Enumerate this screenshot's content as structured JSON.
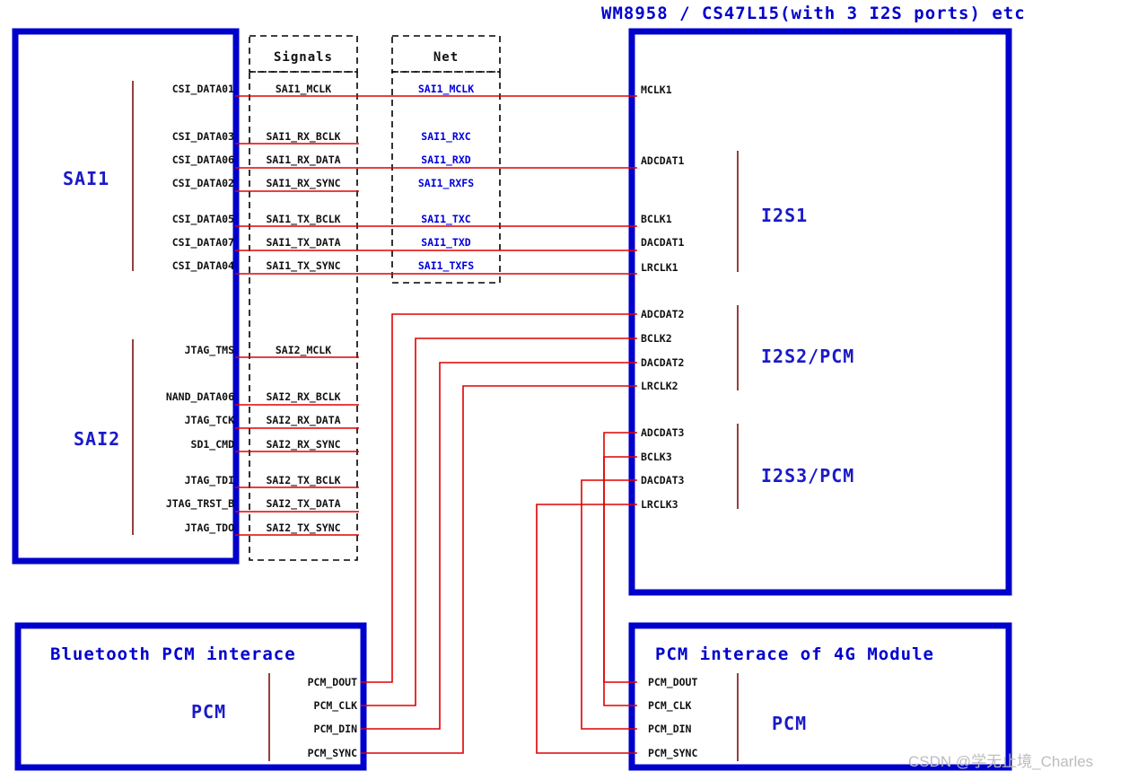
{
  "title": "WM8958 / CS47L15(with 3 I2S ports) etc",
  "watermark": "CSDN @学无止境_Charles",
  "colors": {
    "blue": "#0000cc",
    "red": "#e00000",
    "darkred": "#7a1010",
    "black": "#111111"
  },
  "columns": {
    "signals_header": "Signals",
    "net_header": "Net"
  },
  "soc_box": {
    "groups": [
      {
        "label": "SAI1",
        "pins": [
          "CSI_DATA01",
          "CSI_DATA03",
          "CSI_DATA06",
          "CSI_DATA02",
          "CSI_DATA05",
          "CSI_DATA07",
          "CSI_DATA04"
        ]
      },
      {
        "label": "SAI2",
        "pins": [
          "JTAG_TMS",
          "NAND_DATA06",
          "JTAG_TCK",
          "SD1_CMD",
          "JTAG_TDI",
          "JTAG_TRST_B",
          "JTAG_TDO"
        ]
      }
    ]
  },
  "signals": [
    "SAI1_MCLK",
    "SAI1_RX_BCLK",
    "SAI1_RX_DATA",
    "SAI1_RX_SYNC",
    "SAI1_TX_BCLK",
    "SAI1_TX_DATA",
    "SAI1_TX_SYNC",
    "SAI2_MCLK",
    "SAI2_RX_BCLK",
    "SAI2_RX_DATA",
    "SAI2_RX_SYNC",
    "SAI2_TX_BCLK",
    "SAI2_TX_DATA",
    "SAI2_TX_SYNC"
  ],
  "nets": [
    "SAI1_MCLK",
    "SAI1_RXC",
    "SAI1_RXD",
    "SAI1_RXFS",
    "SAI1_TXC",
    "SAI1_TXD",
    "SAI1_TXFS"
  ],
  "codec_box": {
    "groups": [
      {
        "label": "I2S1",
        "pins": [
          "MCLK1",
          "ADCDAT1",
          "BCLK1",
          "DACDAT1",
          "LRCLK1"
        ]
      },
      {
        "label": "I2S2/PCM",
        "pins": [
          "ADCDAT2",
          "BCLK2",
          "DACDAT2",
          "LRCLK2"
        ]
      },
      {
        "label": "I2S3/PCM",
        "pins": [
          "ADCDAT3",
          "BCLK3",
          "DACDAT3",
          "LRCLK3"
        ]
      }
    ]
  },
  "bluetooth_box": {
    "title": "Bluetooth PCM interace",
    "group_label": "PCM",
    "pins": [
      "PCM_DOUT",
      "PCM_CLK",
      "PCM_DIN",
      "PCM_SYNC"
    ]
  },
  "module_box": {
    "title": "PCM interace of 4G Module",
    "group_label": "PCM",
    "pins": [
      "PCM_DOUT",
      "PCM_CLK",
      "PCM_DIN",
      "PCM_SYNC"
    ]
  }
}
